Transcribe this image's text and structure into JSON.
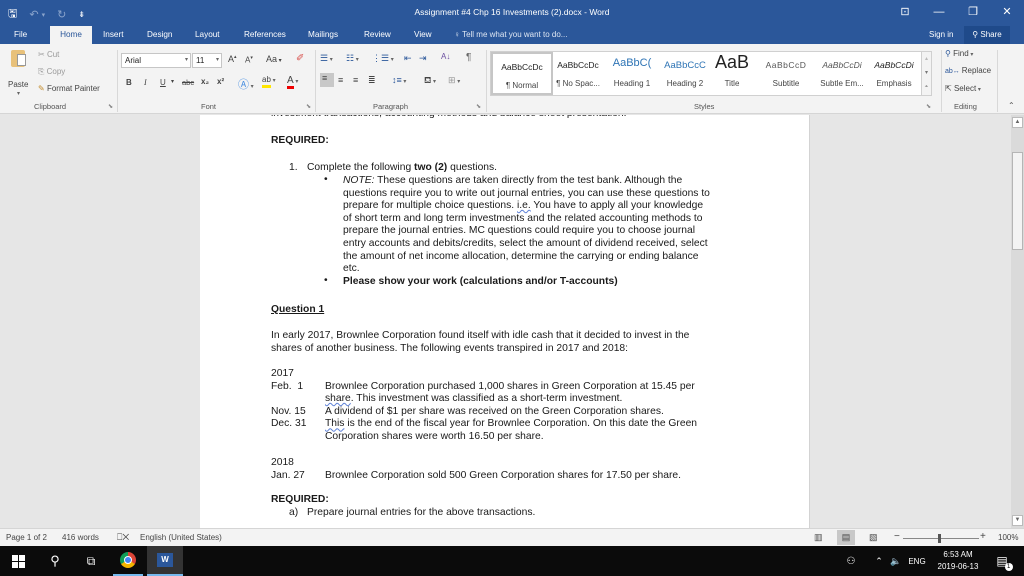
{
  "window": {
    "title": "Assignment #4 Chp 16 Investments (2).docx - Word",
    "controls": {
      "ribbon_display": "⊡",
      "minimize": "—",
      "restore": "❐",
      "close": "✕"
    }
  },
  "qat": {
    "save": "🖫",
    "undo": "↶",
    "undo_dd": "▾",
    "redo": "↻",
    "customize": "⇟"
  },
  "tabs": [
    {
      "label": "File"
    },
    {
      "label": "Home"
    },
    {
      "label": "Insert"
    },
    {
      "label": "Design"
    },
    {
      "label": "Layout"
    },
    {
      "label": "References"
    },
    {
      "label": "Mailings"
    },
    {
      "label": "Review"
    },
    {
      "label": "View"
    }
  ],
  "tell_me": "Tell me what you want to do...",
  "sign_in": "Sign in",
  "share": "Share",
  "ribbon": {
    "clipboard": {
      "label": "Clipboard",
      "paste": "Paste",
      "cut": "Cut",
      "copy": "Copy",
      "format_painter": "Format Painter"
    },
    "font": {
      "label": "Font",
      "font_name": "Arial",
      "font_size": "11",
      "grow": "A",
      "shrink": "A",
      "case": "Aa",
      "bold": "B",
      "italic": "I",
      "underline": "U",
      "strike": "abc",
      "subscript": "x₂",
      "superscript": "x²"
    },
    "paragraph": {
      "label": "Paragraph",
      "pilcrow": "¶"
    },
    "styles": {
      "label": "Styles",
      "items": [
        {
          "sample": "AaBbCcDc",
          "name": "¶ Normal"
        },
        {
          "sample": "AaBbCcDc",
          "name": "¶ No Spac..."
        },
        {
          "sample": "AaBbC(",
          "name": "Heading 1"
        },
        {
          "sample": "AaBbCcC",
          "name": "Heading 2"
        },
        {
          "sample": "AaB",
          "name": "Title"
        },
        {
          "sample": "AaBbCcD",
          "name": "Subtitle"
        },
        {
          "sample": "AaBbCcDi",
          "name": "Subtle Em..."
        },
        {
          "sample": "AaBbCcDi",
          "name": "Emphasis"
        }
      ]
    },
    "editing": {
      "label": "Editing",
      "find": "Find",
      "replace": "Replace",
      "select": "Select"
    }
  },
  "document": {
    "top_line": "investment transactions, accounting methods and balance sheet presentation.",
    "required_1": "REQUIRED:",
    "item1_num": "1.",
    "item1_pre": "Complete the following ",
    "item1_bold": "two (2)",
    "item1_post": " questions.",
    "note_label": "NOTE:",
    "note_lines": [
      " These questions are taken directly from the test bank. Although the",
      "questions require you to write out journal entries, you can use these questions to",
      "prepare for multiple choice questions. ",
      "of short term and long term investments and the related accounting methods to",
      "prepare the journal entries. MC questions could require you to choose journal",
      "entry accounts and debits/credits, select the amount of dividend received, select",
      "the amount of net income allocation, determine the carrying or ending balance",
      "etc."
    ],
    "note_ie": "i.e.",
    "note_line3_tail": " You have to apply all your knowledge",
    "bullet2": "Please show your work (calculations and/or T-accounts)",
    "question_heading": "Question 1",
    "intro_lines": [
      "In early 2017, Brownlee Corporation found itself with idle cash that it decided to invest in the",
      "shares of another business. The following events transpired in 2017 and 2018:"
    ],
    "year1": "2017",
    "events_2017": [
      {
        "date": "Feb.  1",
        "lines": [
          "Brownlee Corporation purchased 1,000 shares in Green Corporation at 15.45 per"
        ]
      },
      {
        "date": "",
        "lines": [
          "share",
          ". This investment was classified as a short-term investment."
        ]
      },
      {
        "date": "Nov. 15",
        "lines": [
          "A dividend of $1 per share was received on the Green Corporation shares."
        ]
      },
      {
        "date": "Dec. 31",
        "lines": [
          "This",
          " is the end of the fiscal year for Brownlee Corporation. On this date the Green"
        ]
      },
      {
        "date": "",
        "lines": [
          "Corporation shares were worth 16.50 per share."
        ]
      }
    ],
    "year2": "2018",
    "event_2018": {
      "date": "Jan. 27",
      "text": "Brownlee Corporation sold 500 Green Corporation shares for 17.50 per share."
    },
    "required_2": "REQUIRED:",
    "req_a_label": "a)",
    "req_a_text": "Prepare journal entries for the above transactions."
  },
  "statusbar": {
    "page": "Page 1 of 2",
    "words": "416 words",
    "language": "English (United States)",
    "zoom": "100%",
    "zoom_level_percent": 100
  },
  "taskbar": {
    "time": "6:53 AM",
    "date": "2019-06-13",
    "lang": "ENG",
    "notifications": "1"
  }
}
